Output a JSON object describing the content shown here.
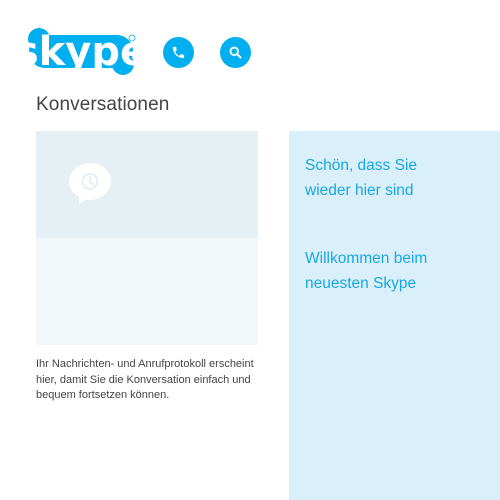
{
  "header": {
    "logo_text": "skype",
    "call_button_icon": "phone-icon",
    "search_button_icon": "search-icon",
    "brand_color": "#00aff0"
  },
  "conversations": {
    "title": "Konversationen",
    "placeholder_icon": "chat-bubble-clock-icon",
    "empty_text": "Ihr Nachrichten- und Anrufprotokoll erscheint hier, damit Sie die Konversation einfach und bequem fortsetzen können."
  },
  "welcome": {
    "line1": "Schön, dass Sie wieder hier sind",
    "line2": "Willkommen beim neuesten Skype",
    "panel_color": "#d9f0fa",
    "text_color": "#1aa7e2"
  }
}
